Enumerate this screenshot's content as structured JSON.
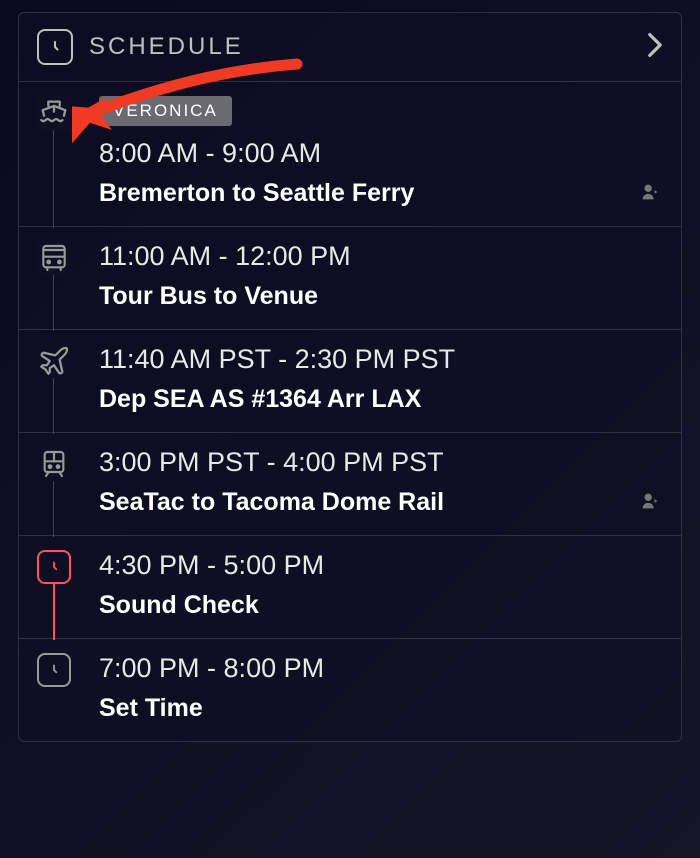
{
  "header": {
    "title": "SCHEDULE"
  },
  "items": [
    {
      "badge": "VERONICA",
      "time": "8:00 AM - 9:00 AM",
      "title": "Bremerton to Seattle Ferry",
      "icon": "ship",
      "has_person": true
    },
    {
      "time": "11:00 AM - 12:00 PM",
      "title": "Tour Bus to Venue",
      "icon": "bus"
    },
    {
      "time": "11:40 AM PST - 2:30 PM PST",
      "title": "Dep SEA AS #1364 Arr LAX",
      "icon": "plane"
    },
    {
      "time": "3:00 PM PST - 4:00 PM PST",
      "title": "SeaTac to Tacoma Dome Rail",
      "icon": "train",
      "has_person": true
    },
    {
      "time": "4:30 PM - 5:00 PM",
      "title": "Sound Check",
      "icon": "clock-red"
    },
    {
      "time": "7:00 PM - 8:00 PM",
      "title": "Set Time",
      "icon": "clock"
    }
  ]
}
